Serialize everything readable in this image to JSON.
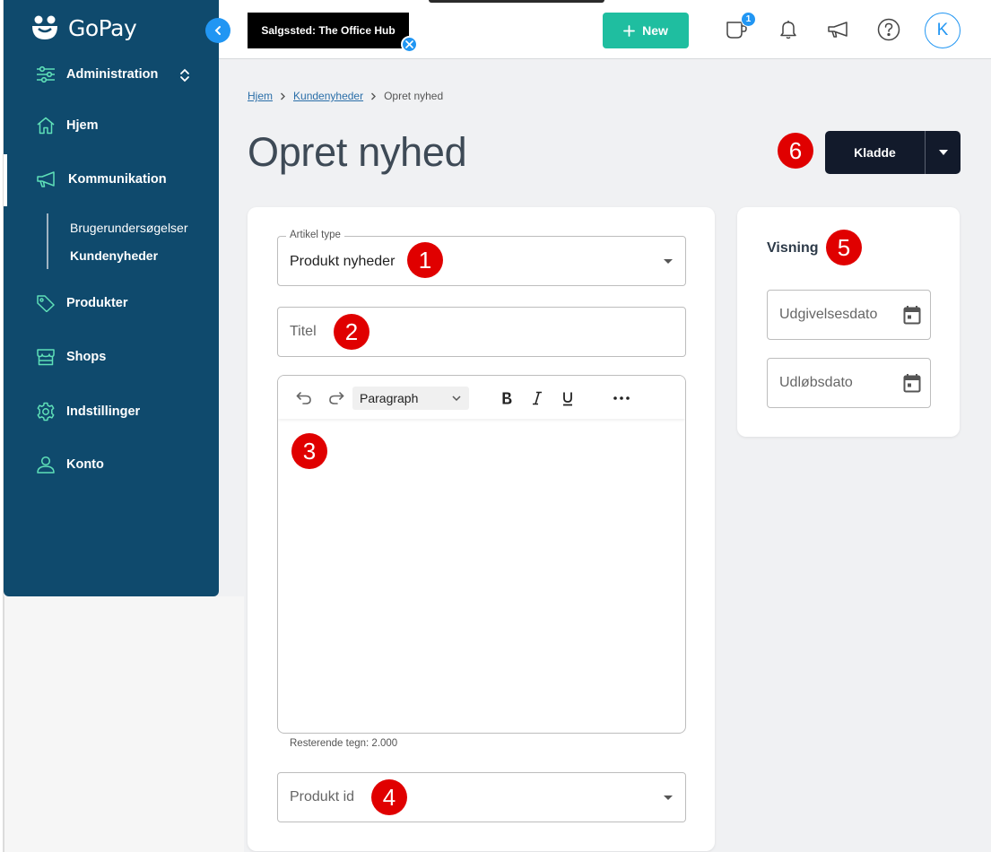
{
  "app": {
    "name": "GoPay"
  },
  "sidebar": {
    "section": "Administration",
    "items": [
      {
        "label": "Hjem",
        "icon": "home-icon"
      },
      {
        "label": "Kommunikation",
        "icon": "megaphone-icon"
      },
      {
        "label": "Produkter",
        "icon": "tag-icon"
      },
      {
        "label": "Shops",
        "icon": "store-icon"
      },
      {
        "label": "Indstillinger",
        "icon": "gear-icon"
      },
      {
        "label": "Konto",
        "icon": "user-icon"
      }
    ],
    "sub_items": [
      {
        "label": "Brugerundersøgelser"
      },
      {
        "label": "Kundenyheder"
      }
    ]
  },
  "topbar": {
    "store_chip": "Salgssted: The Office Hub",
    "new_button": "New",
    "new_icon": "plus-icon",
    "notification_count": "1",
    "avatar_letter": "K"
  },
  "breadcrumb": {
    "items": [
      {
        "label": "Hjem"
      },
      {
        "label": "Kundenyheder"
      },
      {
        "label": "Opret nyhed"
      }
    ]
  },
  "page": {
    "title": "Opret nyhed",
    "status_button": "Kladde"
  },
  "form": {
    "article_type_label": "Artikel type",
    "article_type_value": "Produkt nyheder",
    "title_placeholder": "Titel",
    "editor": {
      "paragraph_select": "Paragraph",
      "remaining_chars": "Resterende tegn: 2.000"
    },
    "product_id_placeholder": "Produkt id"
  },
  "visning": {
    "heading": "Visning",
    "publish_date_placeholder": "Udgivelsesdato",
    "expiry_date_placeholder": "Udløbsdato"
  },
  "markers": [
    "1",
    "2",
    "3",
    "4",
    "5",
    "6"
  ],
  "colors": {
    "sidebar_bg": "#0f4a6d",
    "accent_blue": "#2196f3",
    "new_button_green": "#1fbea0",
    "dark_button": "#121a2b",
    "marker_red": "#e00000",
    "icon_mint": "#5fe0b8"
  }
}
